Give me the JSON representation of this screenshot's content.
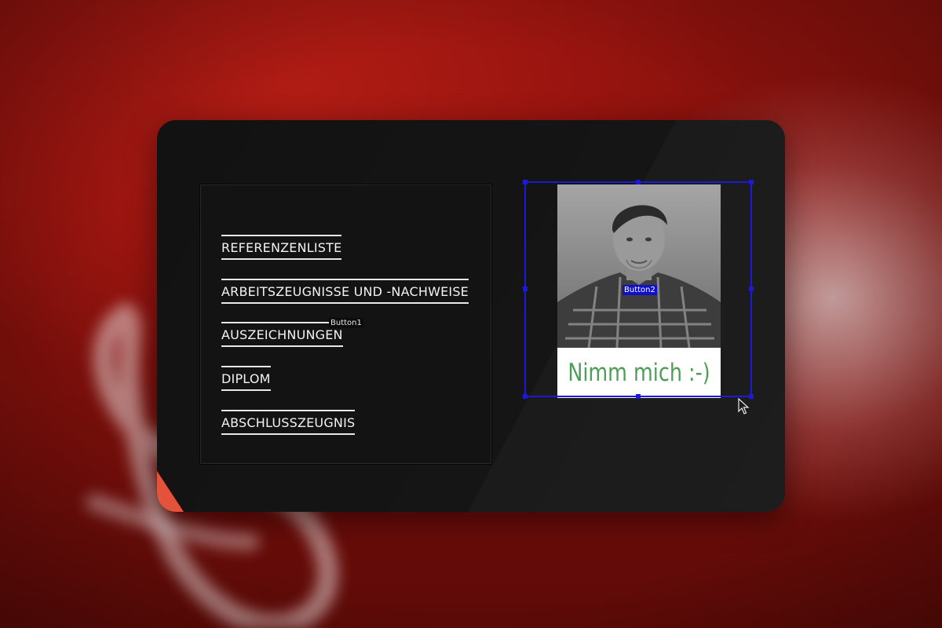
{
  "nav": {
    "items": [
      {
        "label": "REFERENZENLISTE"
      },
      {
        "label": "ARBEITSZEUGNISSE UND -NACHWEISE"
      },
      {
        "label": "AUSZEICHNUNGEN"
      },
      {
        "label": "DIPLOM"
      },
      {
        "label": "ABSCHLUSSZEUGNIS"
      }
    ]
  },
  "buttons": {
    "button1_name": "Button1",
    "button2_name": "Button2"
  },
  "photo": {
    "caption": "Nimm mich :-)"
  },
  "colors": {
    "card_bg": "#141414",
    "nav_text": "#f2f2f2",
    "selection_blue": "#1a1ad8",
    "caption_green": "#4e9d58",
    "accent_orange": "#e2533a",
    "backdrop_red": "#a8190f"
  },
  "icons": {
    "background_logo": "acrobat-logo-icon",
    "cursor": "mouse-pointer-icon"
  }
}
